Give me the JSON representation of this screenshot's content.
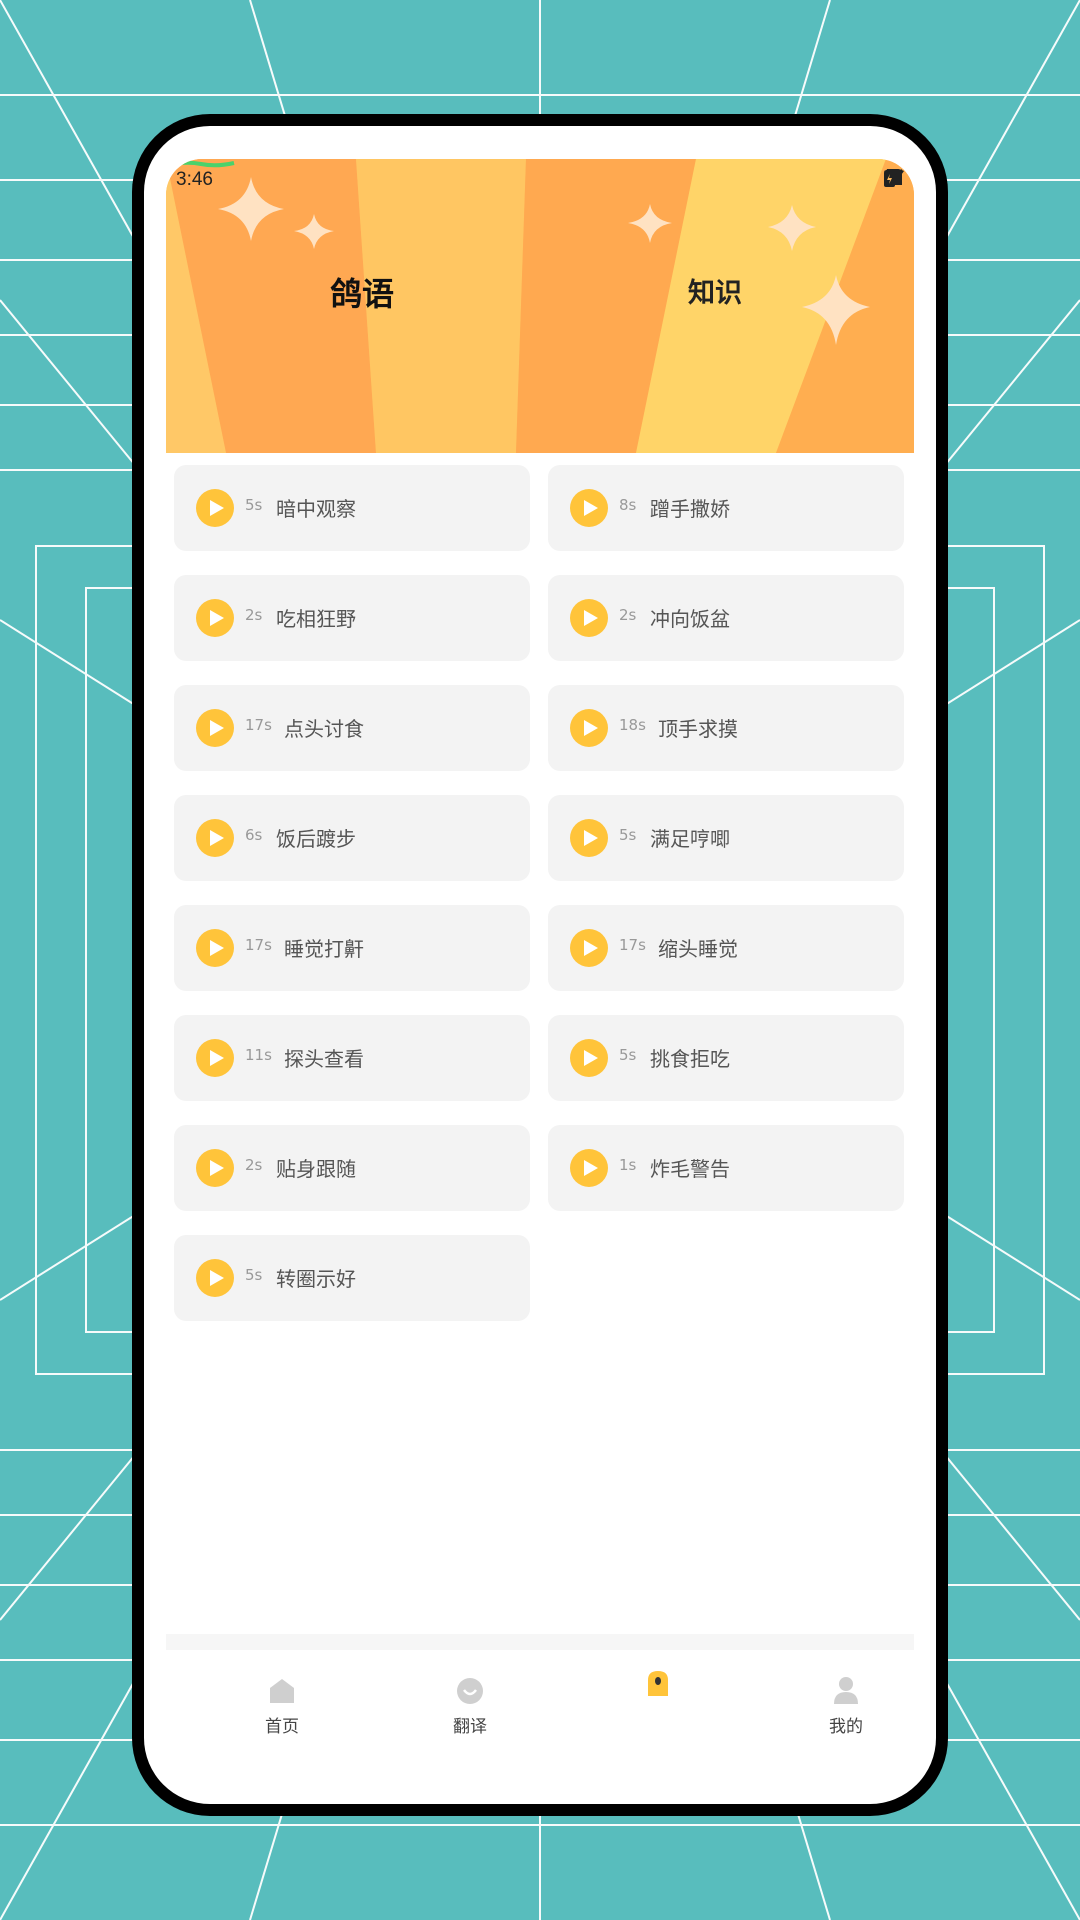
{
  "status_bar": {
    "time": "3:46"
  },
  "header": {
    "tabs": [
      {
        "label": "鸽语",
        "active": true
      },
      {
        "label": "知识",
        "active": false
      }
    ]
  },
  "sounds": [
    {
      "duration": "5s",
      "name": "暗中观察"
    },
    {
      "duration": "8s",
      "name": "蹭手撒娇"
    },
    {
      "duration": "2s",
      "name": "吃相狂野"
    },
    {
      "duration": "2s",
      "name": "冲向饭盆"
    },
    {
      "duration": "17s",
      "name": "点头讨食"
    },
    {
      "duration": "18s",
      "name": "顶手求摸"
    },
    {
      "duration": "6s",
      "name": "饭后踱步"
    },
    {
      "duration": "5s",
      "name": "满足哼唧"
    },
    {
      "duration": "17s",
      "name": "睡觉打鼾"
    },
    {
      "duration": "17s",
      "name": "缩头睡觉"
    },
    {
      "duration": "11s",
      "name": "探头查看"
    },
    {
      "duration": "5s",
      "name": "挑食拒吃"
    },
    {
      "duration": "2s",
      "name": "贴身跟随"
    },
    {
      "duration": "1s",
      "name": "炸毛警告"
    },
    {
      "duration": "5s",
      "name": "转圈示好"
    }
  ],
  "bottom_nav": [
    {
      "label": "首页",
      "icon": "home-icon",
      "active": false
    },
    {
      "label": "翻译",
      "icon": "translate-icon",
      "active": false
    },
    {
      "label": "",
      "icon": "pigeon-sound-icon",
      "active": true
    },
    {
      "label": "我的",
      "icon": "profile-icon",
      "active": false
    }
  ],
  "colors": {
    "background": "#58bdbd",
    "accent": "#ffc43a",
    "banner_orange": "#ffa852",
    "banner_yellow": "#ffd468",
    "card": "#f3f3f3"
  }
}
